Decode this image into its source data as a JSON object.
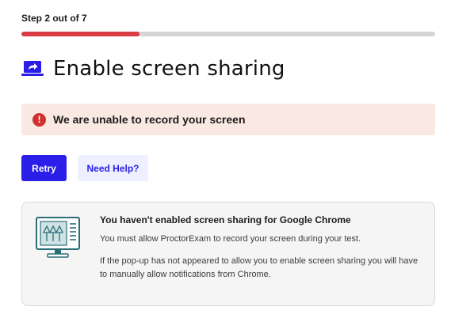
{
  "step": {
    "label": "Step 2 out of 7",
    "progress_fraction": 0.286
  },
  "header": {
    "title": "Enable screen sharing",
    "icon": "screen-share-icon"
  },
  "alert": {
    "icon": "error-icon",
    "glyph": "!",
    "message": "We are unable to record your screen"
  },
  "actions": {
    "retry_label": "Retry",
    "help_label": "Need Help?"
  },
  "info": {
    "illustration": "computer-monitor-icon",
    "heading": "You haven't enabled screen sharing for Google Chrome",
    "paragraph_1": "You must allow ProctorExam to record your screen during your test.",
    "paragraph_2": "If the pop-up has not appeared to allow you to enable screen sharing you will have to manually allow notifications from Chrome."
  },
  "colors": {
    "accent": "#2a1ee8",
    "progress": "#d83b43",
    "alert_bg": "#fae8e2",
    "alert_icon": "#d2302f",
    "illustration": "#2a6e75"
  }
}
